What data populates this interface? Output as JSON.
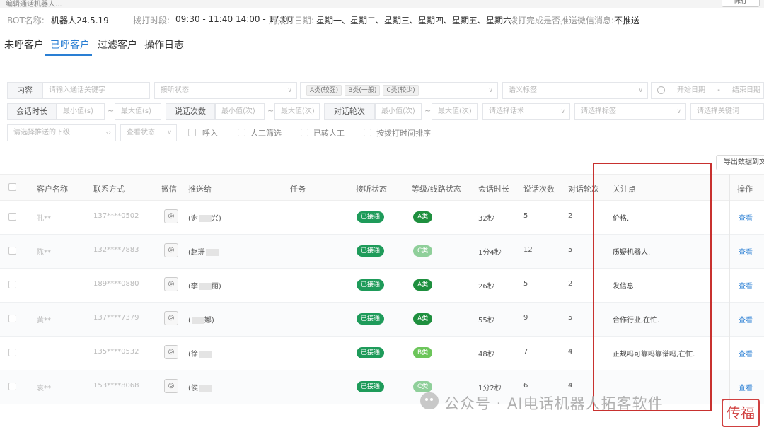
{
  "topbar": {
    "crumb": "编辑通话机器人...",
    "btn": "保存"
  },
  "info": {
    "bot_label": "BOT名称:",
    "bot_value": "机器人24.5.19",
    "time_label": "拨打时段:",
    "time_value": "09:30 - 11:40 14:00 - 17:00",
    "week_label": "周拨打日期:",
    "week_value": "星期一、星期二、星期三、星期四、星期五、星期六",
    "push_label": "拨打完成是否推送微信消息:",
    "push_value": "不推送"
  },
  "tabs": [
    "未呼客户",
    "已呼客户",
    "过滤客户",
    "操作日志"
  ],
  "filters": {
    "content_label": "内容",
    "content_ph": "请输入通话关键字",
    "answer_ph": "接听状态",
    "grades": [
      "A类(较强)",
      "B类(一般)",
      "C类(较少)"
    ],
    "semantic_ph": "语义标签",
    "start_ph": "开始日期",
    "date_sep": "-",
    "end_ph": "结束日期",
    "duration_label": "会话时长",
    "min_ph": "最小值(s)",
    "max_ph": "最大值(s)",
    "speak_label": "说话次数",
    "speak_min_ph": "最小值(次)",
    "speak_max_ph": "最大值(次)",
    "rounds_label": "对话轮次",
    "rounds_min_ph": "最小值(次)",
    "rounds_max_ph": "最大值(次)",
    "script_ph": "请选择话术",
    "tag_ph": "请选择标签",
    "keyword_ph": "请选择关键词",
    "channel_ph": "请选择推送的下级",
    "view_ph": "查看状态",
    "checks": [
      "呼入",
      "人工筛选",
      "已转人工",
      "按拨打时间排序"
    ]
  },
  "export_label": "导出数据到文件",
  "table": {
    "headers": [
      "客户名称",
      "联系方式",
      "微信",
      "推送给",
      "任务",
      "接听状态",
      "等级/线路状态",
      "会话时长",
      "说话次数",
      "对话轮次",
      "关注点",
      "操作"
    ],
    "rows": [
      {
        "name": "孔**",
        "phone": "137****0502",
        "push": "(谢",
        "push2": "兴)",
        "status": "已接通",
        "grade": "A类",
        "grade_color": "#1e8f3e",
        "duration": "32秒",
        "speaks": "5",
        "rounds": "2",
        "focus": "价格.",
        "action": "查看"
      },
      {
        "name": "陈**",
        "phone": "132****7883",
        "push": "(赵珊",
        "push2": "",
        "status": "已接通",
        "grade": "C类",
        "grade_color": "#8fcf9a",
        "duration": "1分4秒",
        "speaks": "12",
        "rounds": "5",
        "focus": "质疑机器人.",
        "action": "查看"
      },
      {
        "name": "",
        "phone": "189****0880",
        "push": "(李",
        "push2": "丽)",
        "status": "已接通",
        "grade": "A类",
        "grade_color": "#1e8f3e",
        "duration": "26秒",
        "speaks": "5",
        "rounds": "2",
        "focus": "发信息.",
        "action": "查看"
      },
      {
        "name": "黄**",
        "phone": "137****7379",
        "push": "(",
        "push2": "娜)",
        "status": "已接通",
        "grade": "A类",
        "grade_color": "#1e8f3e",
        "duration": "55秒",
        "speaks": "9",
        "rounds": "5",
        "focus": "合作行业,在忙.",
        "action": "查看"
      },
      {
        "name": "",
        "phone": "135****0532",
        "push": "(徐",
        "push2": "",
        "status": "已接通",
        "grade": "B类",
        "grade_color": "#6cc55a",
        "duration": "48秒",
        "speaks": "7",
        "rounds": "4",
        "focus": "正规吗可靠吗靠谱吗,在忙.",
        "action": "查看"
      },
      {
        "name": "袁**",
        "phone": "153****8068",
        "push": "(侯",
        "push2": "",
        "status": "已接通",
        "grade": "C类",
        "grade_color": "#8fcf9a",
        "duration": "1分2秒",
        "speaks": "6",
        "rounds": "4",
        "focus": "",
        "action": "查看"
      }
    ]
  },
  "watermark": "公众号 · AI电话机器人拓客软件",
  "stamp": "传福"
}
